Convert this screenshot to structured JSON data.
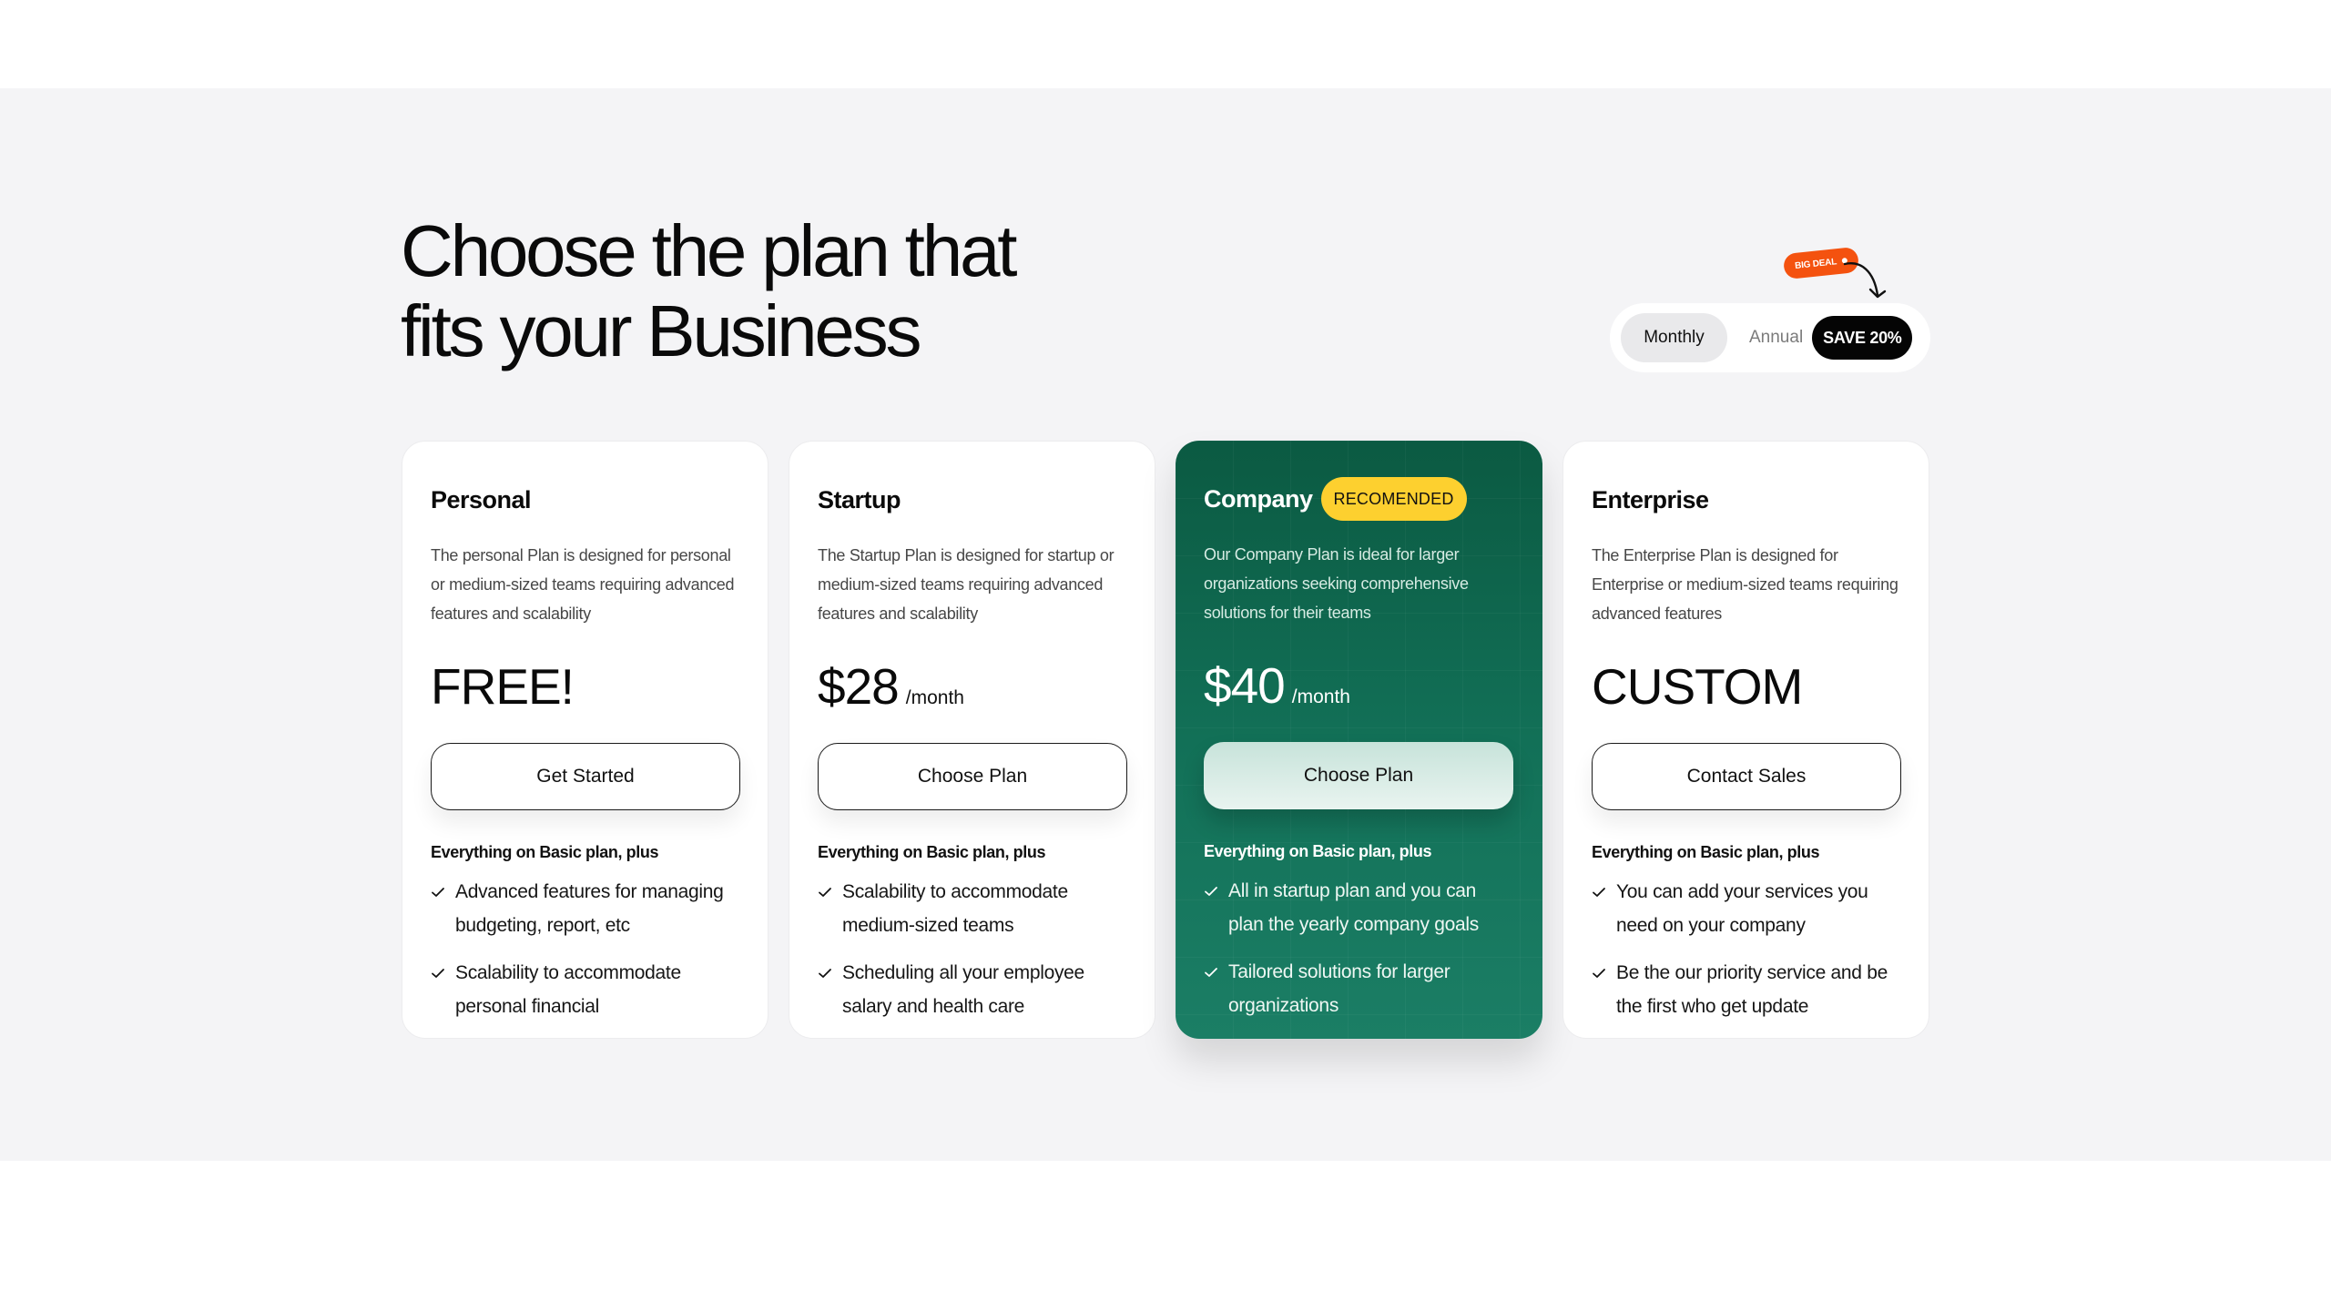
{
  "header": {
    "title_line1": "Choose the plan that",
    "title_line2": "fits your Business"
  },
  "billing_toggle": {
    "monthly_label": "Monthly",
    "annual_label": "Annual",
    "save_badge": "SAVE 20%",
    "selected": "Monthly",
    "promo_tag": "BIG DEAL",
    "arrow_icon": "curved-arrow-down"
  },
  "colors": {
    "accent_green": "#127057",
    "badge_yellow": "#fdd02f",
    "promo_orange": "#f4520f",
    "page_bg": "#f4f4f6"
  },
  "plans": [
    {
      "name": "Personal",
      "description": "The personal Plan is designed for personal or medium-sized teams requiring advanced features and scalability",
      "price": "FREE!",
      "period": "",
      "cta": "Get Started",
      "includes": "Everything on Basic plan, plus",
      "features": [
        "Advanced features for managing budgeting, report, etc",
        "Scalability to accommodate personal financial"
      ]
    },
    {
      "name": "Startup",
      "description": "The Startup Plan is designed for startup or medium-sized teams requiring advanced features and scalability",
      "price": "$28",
      "period": "/month",
      "cta": "Choose Plan",
      "includes": "Everything on Basic plan, plus",
      "features": [
        "Scalability to accommodate medium-sized teams",
        "Scheduling all your employee salary and health care"
      ]
    },
    {
      "name": "Company",
      "badge": "RECOMENDED",
      "description": "Our Company Plan is ideal for larger organizations seeking comprehensive solutions for their teams",
      "price": "$40",
      "period": "/month",
      "cta": "Choose Plan",
      "includes": "Everything on Basic plan, plus",
      "features": [
        "All in startup plan and you can plan the yearly company goals",
        "Tailored solutions for larger organizations"
      ]
    },
    {
      "name": "Enterprise",
      "description": "The Enterprise Plan is designed for Enterprise or medium-sized teams requiring advanced features",
      "price": "CUSTOM",
      "period": "",
      "cta": "Contact Sales",
      "includes": "Everything on Basic plan, plus",
      "features": [
        "You can add your services you need on your company",
        "Be the our priority service and be the first who get update"
      ]
    }
  ]
}
